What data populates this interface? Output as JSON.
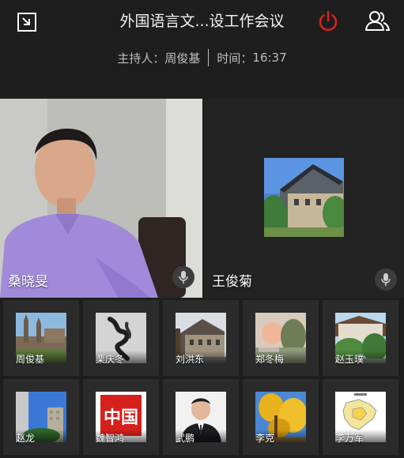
{
  "header": {
    "title": "外国语言文...设工作会议",
    "host_label": "主持人：",
    "host_name": "周俊基",
    "time_label": "时间：",
    "time_value": "16:37"
  },
  "icons": {
    "exit": "minimize-window-icon",
    "power": "power-icon",
    "members": "members-icon",
    "mic": "microphone-icon"
  },
  "colors": {
    "background": "#1e1e1e",
    "power_red": "#e2231a",
    "tile": "#2b2b2b"
  },
  "main_videos": [
    {
      "name": "桑晓旻"
    },
    {
      "name": "王俊菊"
    }
  ],
  "participants": [
    {
      "name": "周俊基"
    },
    {
      "name": "栗庆冬"
    },
    {
      "name": "刘洪东"
    },
    {
      "name": "郑冬梅"
    },
    {
      "name": "赵玉璞"
    },
    {
      "name": "赵龙"
    },
    {
      "name": "魏智鸿"
    },
    {
      "name": "武鹏"
    },
    {
      "name": "李克"
    },
    {
      "name": "李万军"
    }
  ],
  "avatar_stamp_text": "中国"
}
